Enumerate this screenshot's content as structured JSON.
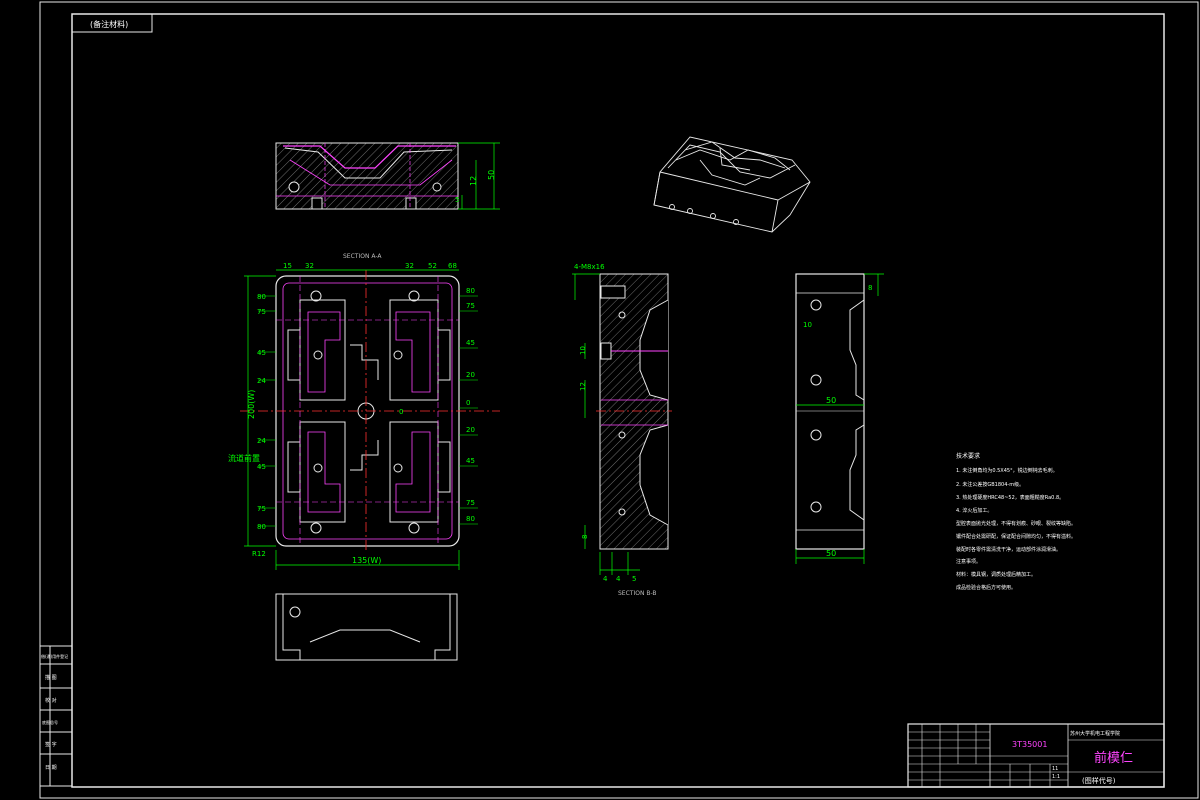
{
  "drawing": {
    "corner_tag": "(备注材料)",
    "sections": {
      "a_a": "SECTION A-A",
      "b_b": "SECTION B-B"
    },
    "top_view": {
      "dim_overall_height": "50",
      "dim_inner": "12",
      "dim_small": "5"
    },
    "plan_view": {
      "top_dims": [
        "15",
        "32",
        "32",
        "52",
        "68"
      ],
      "left_dims": [
        "80",
        "75",
        "45",
        "24",
        "24",
        "45",
        "75",
        "80"
      ],
      "right_dims": [
        "80",
        "75",
        "45",
        "20",
        "0",
        "20",
        "45",
        "75",
        "80"
      ],
      "overall_width": "135(W)",
      "overall_height": "200(W)",
      "center_dim": "0",
      "radius": "R12",
      "callout": "流道前置"
    },
    "section_b": {
      "top_dim": "4-M8x16",
      "left_dims": [
        "10",
        "12",
        "8"
      ],
      "bottom_dims": [
        "4",
        "4",
        "5"
      ]
    },
    "side_view": {
      "width": "50",
      "bottom_width": "50",
      "small_dims": [
        "8",
        "10"
      ]
    },
    "notes": {
      "heading": "技术要求",
      "lines": [
        "1. 未注倒角均为0.5X45°，锐边倒钝去毛刺。",
        "2. 未注公差按GB1804-m级。",
        "3. 热处理硬度HRC48~52，表面粗糙度Ra0.8。",
        "4. 淬火后加工。",
        "型腔表面抛光处理，不得有划痕、砂眼、裂纹等缺陷。",
        "镶件配合处需研配，保证配合间隙均匀，不得有溢料。",
        "装配时各零件需清洗干净，运动部件涂润滑油。",
        "注意事项。",
        "    材料：模具钢，调质处理后精加工。",
        "    成品检验合格后方可使用。"
      ]
    },
    "left_strip": {
      "labels": [
        "借(通)用件登记",
        "描 图",
        "校 对",
        "底图总号",
        "签 字",
        "日 期"
      ]
    },
    "title_block": {
      "part_number": "3T35001",
      "school": "苏州大学机电工程学院",
      "part_name": "前模仁",
      "drawing_code": "(图样代号)",
      "scale": "1:1",
      "sheet": "11"
    }
  }
}
